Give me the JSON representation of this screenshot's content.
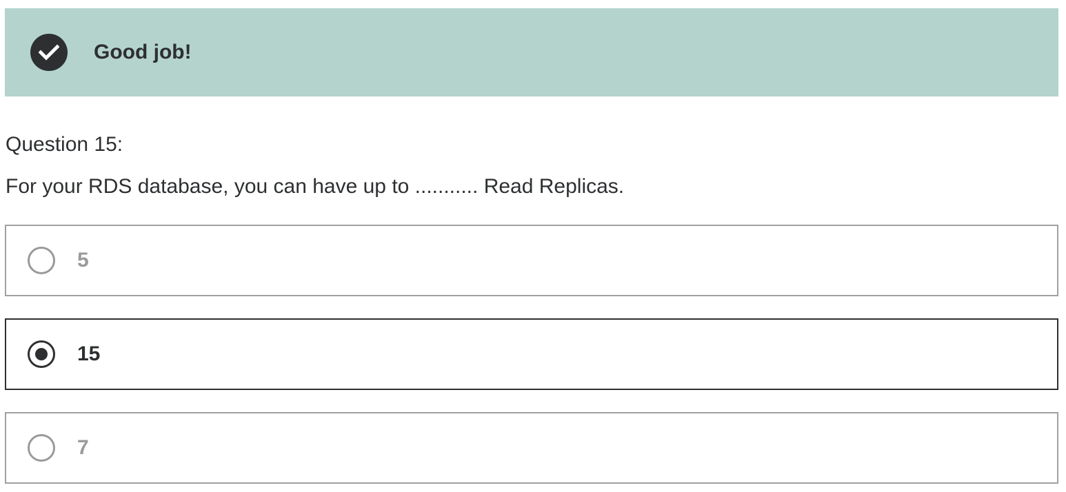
{
  "banner": {
    "icon": "check-circle-icon",
    "message": "Good job!",
    "background_color": "#b4d3cd"
  },
  "question": {
    "number_label": "Question 15:",
    "text": "For your RDS database, you can have up to ........... Read Replicas."
  },
  "options": [
    {
      "label": "5",
      "selected": false
    },
    {
      "label": "15",
      "selected": true
    },
    {
      "label": "7",
      "selected": false
    }
  ]
}
